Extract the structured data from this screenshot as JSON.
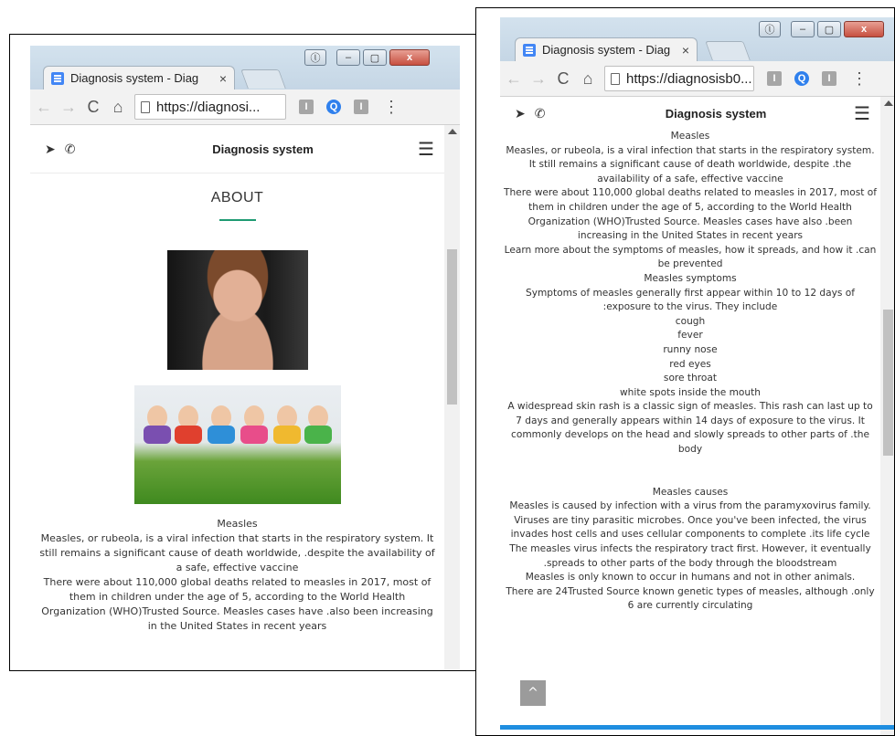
{
  "browser": {
    "tab_title": "Diagnosis system - Diag",
    "tab_close": "×",
    "window_buttons": {
      "profile": "ⓛ",
      "minimize": "–",
      "maximize": "▢",
      "close": "x"
    },
    "nav": {
      "back": "←",
      "forward": "→",
      "reload": "C",
      "home": "⌂"
    },
    "left_url": "https://diagnosi...",
    "right_url": "https://diagnosisb0...",
    "ext1": "I",
    "ext2": "Q",
    "ext3": "I",
    "menu": "⋮"
  },
  "site": {
    "brand": "Diagnosis system",
    "location_icon": "➤",
    "phone_icon": "✆",
    "menu_icon": "☰"
  },
  "about": {
    "title": "ABOUT"
  },
  "left_article": [
    "Measles",
    "Measles, or rubeola, is a viral infection that starts in the respiratory system. It still remains a significant cause of death worldwide, .despite the availability of a safe, effective vaccine",
    "There were about 110,000 global deaths related to measles in 2017, most of them in children under the age of 5, according to the World Health Organization (WHO)Trusted Source. Measles cases have .also been increasing in the United States in recent years"
  ],
  "right_article": [
    "Measles",
    "Measles, or rubeola, is a viral infection that starts in the respiratory system. It still remains a significant cause of death worldwide, despite .the availability of a safe, effective vaccine",
    "There were about 110,000 global deaths related to measles in 2017, most of them in children under the age of 5, according to the World Health Organization (WHO)Trusted Source. Measles cases have also .been increasing in the United States in recent years",
    "Learn more about the symptoms of measles, how it spreads, and how it .can be prevented",
    "Measles symptoms",
    "Symptoms of measles generally first appear within 10 to 12 days of :exposure to the virus. They include",
    "cough",
    "fever",
    "runny nose",
    "red eyes",
    "sore throat",
    "white spots inside the mouth",
    "A widespread skin rash is a classic sign of measles. This rash can last up to 7 days and generally appears within 14 days of exposure to the virus. It commonly develops on the head and slowly spreads to other parts of .the body"
  ],
  "right_article_2": [
    "Measles causes",
    "Measles is caused by infection with a virus from the paramyxovirus family. Viruses are tiny parasitic microbes. Once you've been infected, the virus invades host cells and uses cellular components to complete .its life cycle",
    "The measles virus infects the respiratory tract first. However, it eventually .spreads to other parts of the body through the bloodstream",
    "Measles is only known to occur in humans and not in other animals.",
    "There are 24Trusted Source known genetic types of measles, although .only 6 are currently circulating"
  ],
  "back_to_top": "^",
  "colors": {
    "accent_underline": "#1e9b72",
    "progress_bar": "#1f8ee0",
    "tab_icon": "#4286f5"
  }
}
